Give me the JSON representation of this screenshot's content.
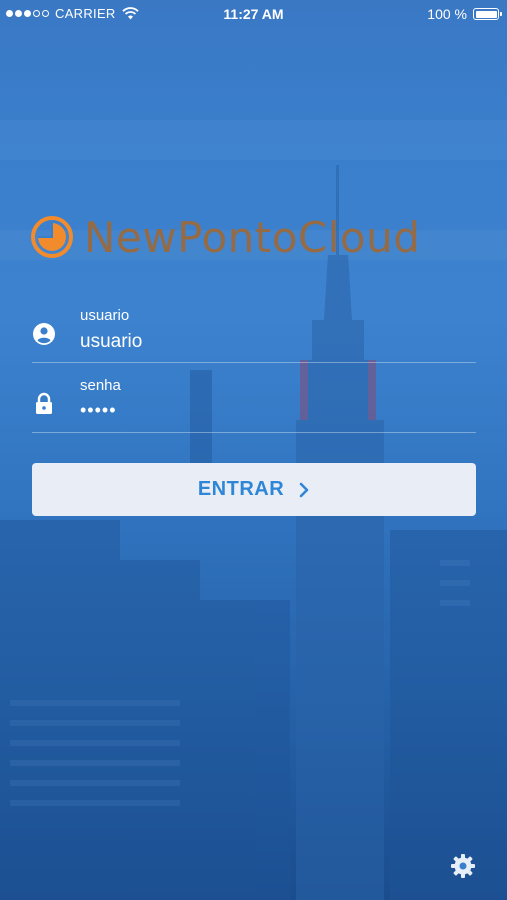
{
  "status_bar": {
    "carrier": "CARRIER",
    "time": "11:27 AM",
    "battery": "100 %",
    "signal_dots_filled": 3,
    "signal_dots_total": 5
  },
  "brand": {
    "name": "NewPontoCloud",
    "accent_color": "#f28b2c",
    "text_color": "#9a6a3e"
  },
  "login": {
    "username": {
      "label": "usuario",
      "value": "usuario",
      "icon": "user-circle-icon"
    },
    "password": {
      "label": "senha",
      "value": "•••••",
      "icon": "lock-icon"
    },
    "submit_label": "ENTRAR",
    "submit_icon": "chevron-right-icon"
  },
  "footer": {
    "settings_icon": "gear-icon"
  },
  "colors": {
    "background": "#3a7fcc",
    "button_bg": "#e9eef6",
    "button_text": "#2f86d6"
  }
}
